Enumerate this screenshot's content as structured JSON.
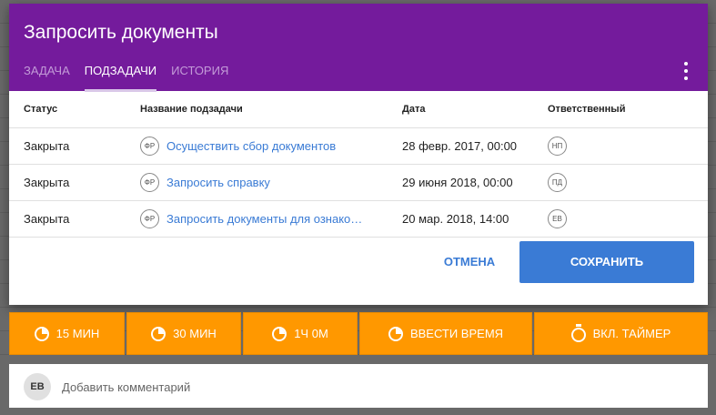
{
  "dialog": {
    "title": "Запросить документы",
    "tabs": [
      {
        "label": "Задача"
      },
      {
        "label": "Подзадачи"
      },
      {
        "label": "История"
      }
    ],
    "active_tab": "Подзадачи",
    "more_icon": "more-vert-icon"
  },
  "table": {
    "headers": [
      "Статус",
      "Название подзадачи",
      "Дата",
      "Ответственный"
    ],
    "rows": [
      {
        "status": "Закрыта",
        "type_badge": "ФР",
        "name": "Осуществить сбор документов",
        "date": "28 февр. 2017, 00:00",
        "assignee": "НП"
      },
      {
        "status": "Закрыта",
        "type_badge": "ФР",
        "name": "Запросить справку",
        "date": "29 июня 2018, 00:00",
        "assignee": "ПД"
      },
      {
        "status": "Закрыта",
        "type_badge": "ФР",
        "name": "Запросить документы для ознакомления",
        "date": "20 мар. 2018, 14:00",
        "assignee": "ЕВ"
      }
    ]
  },
  "actions": {
    "cancel_label": "Отмена",
    "save_label": "Сохранить"
  },
  "time_buttons": [
    {
      "label": "15 мин",
      "icon": "clock-icon"
    },
    {
      "label": "30 мин",
      "icon": "clock-icon"
    },
    {
      "label": "1ч 0м",
      "icon": "clock-icon"
    },
    {
      "label": "Ввести время",
      "icon": "clock-icon"
    },
    {
      "label": "Вкл. таймер",
      "icon": "stopwatch-icon"
    }
  ],
  "comment": {
    "avatar": "ЕВ",
    "placeholder": "Добавить комментарий"
  },
  "colors": {
    "header": "#741b9c",
    "accent": "#3a7bd5",
    "orange": "#ff9800",
    "date": "#6a1b9a"
  }
}
